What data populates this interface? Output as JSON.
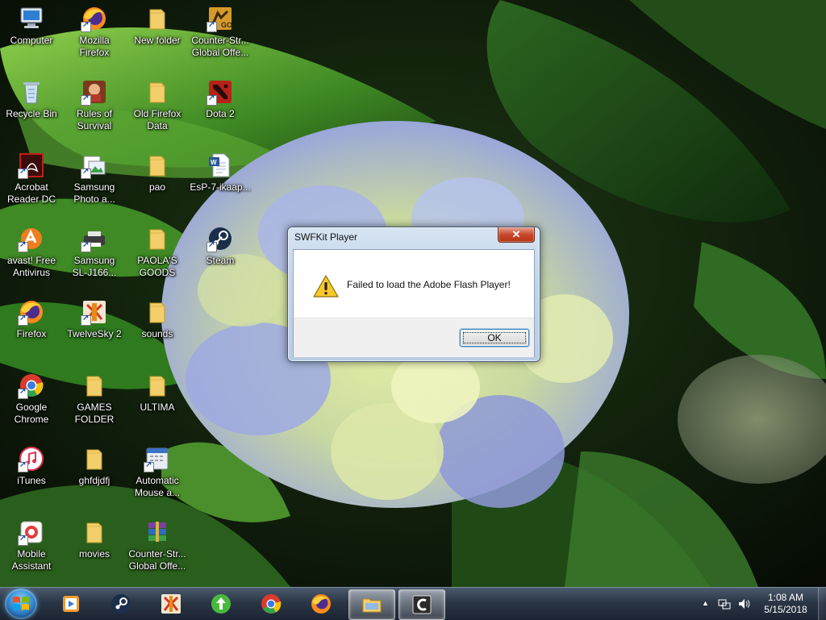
{
  "desktop": {
    "icons": [
      {
        "label": "Computer",
        "icon": "computer-icon"
      },
      {
        "label": "Mozilla\nFirefox",
        "icon": "firefox-icon"
      },
      {
        "label": "New folder",
        "icon": "folder-icon"
      },
      {
        "label": "Counter-Str...\nGlobal Offe...",
        "icon": "csgo-icon"
      },
      {
        "label": "Recycle Bin",
        "icon": "recycle-bin-icon"
      },
      {
        "label": "Rules of\nSurvival",
        "icon": "rules-of-survival-icon"
      },
      {
        "label": "Old Firefox\nData",
        "icon": "folder-icon"
      },
      {
        "label": "Dota 2",
        "icon": "dota2-icon"
      },
      {
        "label": "Acrobat\nReader DC",
        "icon": "acrobat-icon"
      },
      {
        "label": "Samsung\nPhoto a...",
        "icon": "samsung-photo-icon"
      },
      {
        "label": "pao",
        "icon": "folder-icon"
      },
      {
        "label": "EsP-7-ikaap...",
        "icon": "word-document-icon"
      },
      {
        "label": "avast! Free\nAntivirus",
        "icon": "avast-icon"
      },
      {
        "label": "Samsung\nSL-J166...",
        "icon": "printer-icon"
      },
      {
        "label": "PAOLA'S\nGOODS",
        "icon": "folder-icon"
      },
      {
        "label": "Steam",
        "icon": "steam-icon"
      },
      {
        "label": "Firefox",
        "icon": "firefox-icon"
      },
      {
        "label": "TwelveSky 2",
        "icon": "twelvesky-icon"
      },
      {
        "label": "sounds",
        "icon": "folder-icon"
      },
      {
        "label": "Google\nChrome",
        "icon": "chrome-icon"
      },
      {
        "label": "GAMES\nFOLDER",
        "icon": "folder-icon"
      },
      {
        "label": "ULTIMA",
        "icon": "folder-icon"
      },
      {
        "label": "iTunes",
        "icon": "itunes-icon"
      },
      {
        "label": "ghfdjdfj",
        "icon": "folder-icon"
      },
      {
        "label": "Automatic\nMouse a...",
        "icon": "automatic-mouse-icon"
      },
      {
        "label": "Mobile\nAssistant",
        "icon": "mobile-assistant-icon"
      },
      {
        "label": "movies",
        "icon": "folder-icon"
      },
      {
        "label": "Counter-Str...\nGlobal Offe...",
        "icon": "winrar-icon"
      }
    ]
  },
  "dialog": {
    "title": "SWFKit Player",
    "close_glyph": "✕",
    "message": "Failed to load the Adobe Flash Player!",
    "ok_label": "OK"
  },
  "taskbar": {
    "items": [
      {
        "name": "media-player-icon",
        "active": false
      },
      {
        "name": "steam-icon",
        "active": false
      },
      {
        "name": "twelvesky-icon",
        "active": false
      },
      {
        "name": "uploader-icon",
        "active": false
      },
      {
        "name": "chrome-icon",
        "active": false
      },
      {
        "name": "firefox-icon",
        "active": false
      },
      {
        "name": "file-explorer-icon",
        "active": true
      },
      {
        "name": "ccleaner-icon",
        "active": true
      }
    ],
    "tray_arrow": "▲",
    "clock_time": "1:08 AM",
    "clock_date": "5/15/2018"
  }
}
